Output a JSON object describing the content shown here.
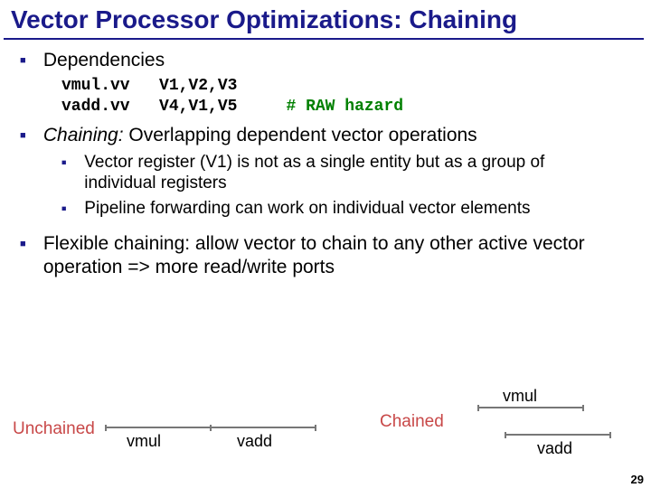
{
  "title": "Vector Processor Optimizations: Chaining",
  "bullets": {
    "dep": "Dependencies",
    "chaining_pre": "Chaining:",
    "chaining_post": " Overlapping dependent vector operations",
    "sub_vreg": "Vector register (V1) is not as a single entity but as a group of individual registers",
    "sub_fwd": "Pipeline forwarding can work on individual vector elements",
    "flex": "Flexible chaining: allow vector to chain to any other active vector operation => more read/write ports"
  },
  "code": {
    "l1a": "vmul.vv",
    "l1b": "V1,V2,V3",
    "l2a": "vadd.vv",
    "l2b": "V4,V1,V5",
    "l2c": "# RAW hazard"
  },
  "diagram": {
    "unchained_label": "Unchained",
    "chained_label": "Chained",
    "vmul": "vmul",
    "vadd": "vadd"
  },
  "pagenum": "29"
}
